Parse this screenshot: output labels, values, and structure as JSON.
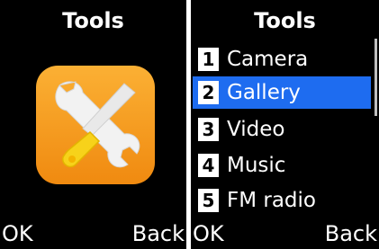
{
  "left_screen": {
    "title": "Tools",
    "app_icon": "tools-icon",
    "softkeys": {
      "left": "OK",
      "right": "Back"
    }
  },
  "right_screen": {
    "title": "Tools",
    "menu_items": [
      {
        "number": "1",
        "label": "Camera",
        "selected": false
      },
      {
        "number": "2",
        "label": "Gallery",
        "selected": true
      },
      {
        "number": "3",
        "label": "Video",
        "selected": false
      },
      {
        "number": "4",
        "label": "Music",
        "selected": false
      },
      {
        "number": "5",
        "label": "FM radio",
        "selected": false
      }
    ],
    "softkeys": {
      "left": "OK",
      "right": "Back"
    }
  },
  "colors": {
    "background": "#000000",
    "highlight": "#1e6cf0",
    "icon_orange": "#f7a21b",
    "text": "#ffffff"
  }
}
